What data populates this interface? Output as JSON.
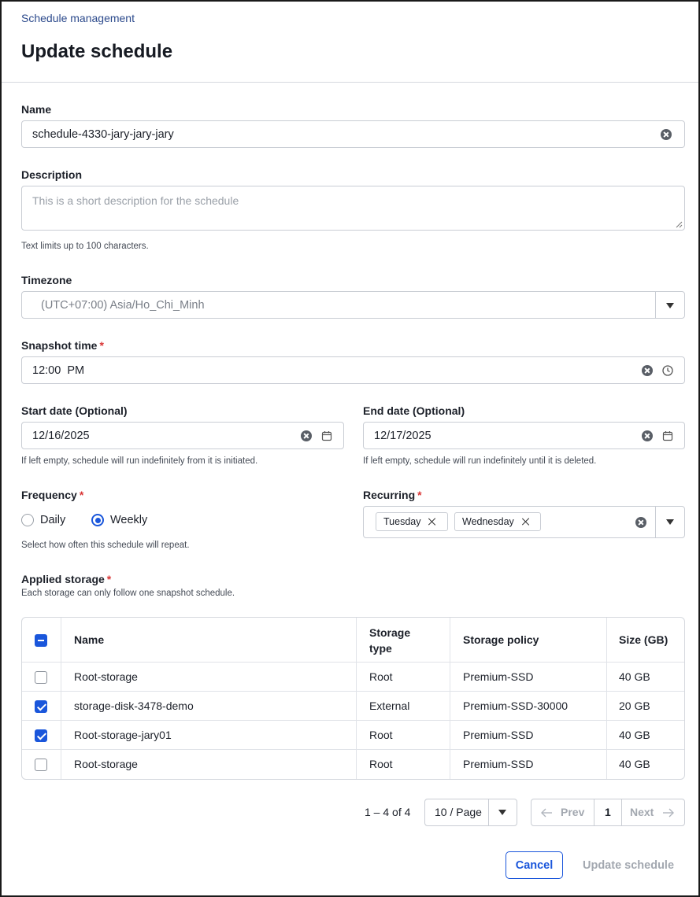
{
  "breadcrumb": "Schedule management",
  "title": "Update schedule",
  "form": {
    "name": {
      "label": "Name",
      "value": "schedule-4330-jary-jary-jary"
    },
    "description": {
      "label": "Description",
      "placeholder": "This is a short description for the schedule",
      "hint": "Text limits up to 100 characters."
    },
    "timezone": {
      "label": "Timezone",
      "value": "(UTC+07:00) Asia/Ho_Chi_Minh"
    },
    "snapshot_time": {
      "label": "Snapshot time",
      "value": "12:00  PM"
    },
    "start_date": {
      "label": "Start date (Optional)",
      "value": "12/16/2025",
      "hint": "If left empty, schedule will run indefinitely from it is initiated."
    },
    "end_date": {
      "label": "End date (Optional)",
      "value": "12/17/2025",
      "hint": "If left empty, schedule will run indefinitely until it is deleted."
    },
    "frequency": {
      "label": "Frequency",
      "options": [
        "Daily",
        "Weekly"
      ],
      "selected": "Weekly",
      "hint": "Select how often this schedule will repeat."
    },
    "recurring": {
      "label": "Recurring",
      "tags": [
        "Tuesday",
        "Wednesday"
      ]
    },
    "required_mark": "*"
  },
  "storage": {
    "label": "Applied storage",
    "hint": "Each storage can only follow one snapshot schedule.",
    "columns": [
      "Name",
      "Storage type",
      "Storage policy",
      "Size (GB)"
    ],
    "rows": [
      {
        "checked": false,
        "name": "Root-storage",
        "type": "Root",
        "policy": "Premium-SSD",
        "size": "40 GB"
      },
      {
        "checked": true,
        "name": "storage-disk-3478-demo",
        "type": "External",
        "policy": "Premium-SSD-30000",
        "size": "20 GB"
      },
      {
        "checked": true,
        "name": "Root-storage-jary01",
        "type": "Root",
        "policy": "Premium-SSD",
        "size": "40 GB"
      },
      {
        "checked": false,
        "name": "Root-storage",
        "type": "Root",
        "policy": "Premium-SSD",
        "size": "40 GB"
      }
    ]
  },
  "pagination": {
    "range": "1 – 4 of 4",
    "page_size": "10 / Page",
    "prev": "Prev",
    "page": "1",
    "next": "Next"
  },
  "actions": {
    "cancel": "Cancel",
    "update": "Update schedule"
  },
  "colors": {
    "accent": "#1a56db",
    "required": "#d93636",
    "breadcrumb": "#2c4a8c"
  },
  "icons": [
    "clear-icon",
    "clock-icon",
    "calendar-icon",
    "chevron-down-icon",
    "arrow-left-icon",
    "arrow-right-icon",
    "close-icon"
  ]
}
